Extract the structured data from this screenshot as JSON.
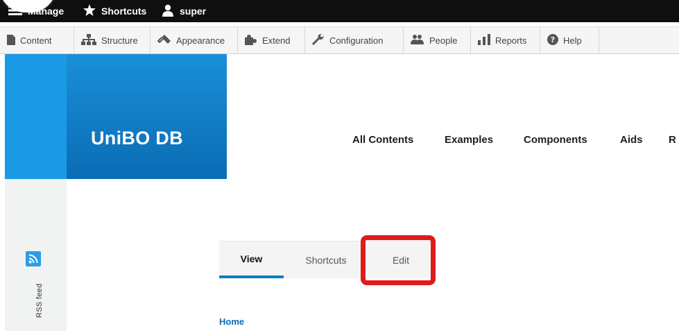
{
  "admin_bar": {
    "manage_label": "Manage",
    "shortcuts_label": "Shortcuts",
    "user_label": "super"
  },
  "tray": {
    "items": [
      {
        "label": "Content",
        "icon": "content-icon"
      },
      {
        "label": "Structure",
        "icon": "structure-icon"
      },
      {
        "label": "Appearance",
        "icon": "appearance-icon"
      },
      {
        "label": "Extend",
        "icon": "extend-icon"
      },
      {
        "label": "Configuration",
        "icon": "configuration-icon"
      },
      {
        "label": "People",
        "icon": "people-icon"
      },
      {
        "label": "Reports",
        "icon": "reports-icon"
      },
      {
        "label": "Help",
        "icon": "help-icon"
      }
    ]
  },
  "site": {
    "name": "UniBO DB"
  },
  "main_nav": {
    "items": [
      "All Contents",
      "Examples",
      "Components",
      "Aids",
      "R"
    ]
  },
  "sidebar": {
    "rss_label": "RSS feed"
  },
  "tabs": {
    "view": "View",
    "shortcuts": "Shortcuts",
    "edit": "Edit"
  },
  "breadcrumb": {
    "home": "Home"
  },
  "colors": {
    "brand_blue": "#1a9ae5",
    "active_tab_underline": "#0a7cc4",
    "annotation_red": "#e01b1b"
  }
}
